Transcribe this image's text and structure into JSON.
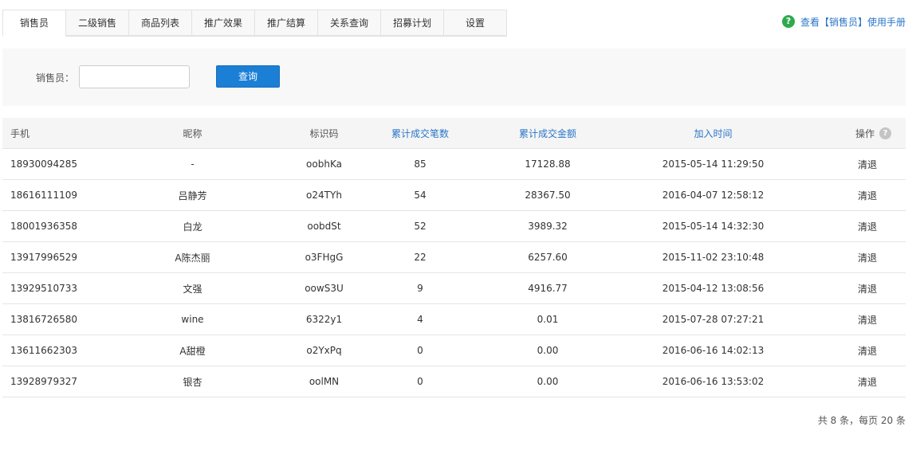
{
  "tabs": [
    {
      "label": "销售员",
      "active": true
    },
    {
      "label": "二级销售",
      "active": false
    },
    {
      "label": "商品列表",
      "active": false
    },
    {
      "label": "推广效果",
      "active": false
    },
    {
      "label": "推广结算",
      "active": false
    },
    {
      "label": "关系查询",
      "active": false
    },
    {
      "label": "招募计划",
      "active": false
    },
    {
      "label": "设置",
      "active": false
    }
  ],
  "help": {
    "icon": "question-icon",
    "text": "查看【销售员】使用手册",
    "icon_color": "#2eaa4e",
    "link_color": "#2a75c7"
  },
  "filter": {
    "label": "销售员：",
    "input_value": "",
    "button_label": "查询",
    "button_color": "#1b7fd6"
  },
  "table": {
    "headers": {
      "phone": "手机",
      "nickname": "昵称",
      "code": "标识码",
      "orders": "累计成交笔数",
      "amount": "累计成交金额",
      "joined": "加入时间",
      "op": "操作"
    },
    "rows": [
      {
        "phone": "18930094285",
        "nickname": "-",
        "code": "oobhKa",
        "orders": "85",
        "amount": "17128.88",
        "joined": "2015-05-14 11:29:50",
        "op": "清退"
      },
      {
        "phone": "18616111109",
        "nickname": "吕静芳",
        "code": "o24TYh",
        "orders": "54",
        "amount": "28367.50",
        "joined": "2016-04-07 12:58:12",
        "op": "清退"
      },
      {
        "phone": "18001936358",
        "nickname": "白龙",
        "code": "oobdSt",
        "orders": "52",
        "amount": "3989.32",
        "joined": "2015-05-14 14:32:30",
        "op": "清退"
      },
      {
        "phone": "13917996529",
        "nickname": "A陈杰丽",
        "code": "o3FHgG",
        "orders": "22",
        "amount": "6257.60",
        "joined": "2015-11-02 23:10:48",
        "op": "清退"
      },
      {
        "phone": "13929510733",
        "nickname": "文强",
        "code": "oowS3U",
        "orders": "9",
        "amount": "4916.77",
        "joined": "2015-04-12 13:08:56",
        "op": "清退"
      },
      {
        "phone": "13816726580",
        "nickname": "wine",
        "code": "6322y1",
        "orders": "4",
        "amount": "0.01",
        "joined": "2015-07-28 07:27:21",
        "op": "清退"
      },
      {
        "phone": "13611662303",
        "nickname": "A甜橙",
        "code": "o2YxPq",
        "orders": "0",
        "amount": "0.00",
        "joined": "2016-06-16 14:02:13",
        "op": "清退"
      },
      {
        "phone": "13928979327",
        "nickname": "银杏",
        "code": "oolMN",
        "orders": "0",
        "amount": "0.00",
        "joined": "2016-06-16 13:53:02",
        "op": "清退"
      }
    ]
  },
  "pager": {
    "text": "共 8 条，每页 20 条"
  }
}
